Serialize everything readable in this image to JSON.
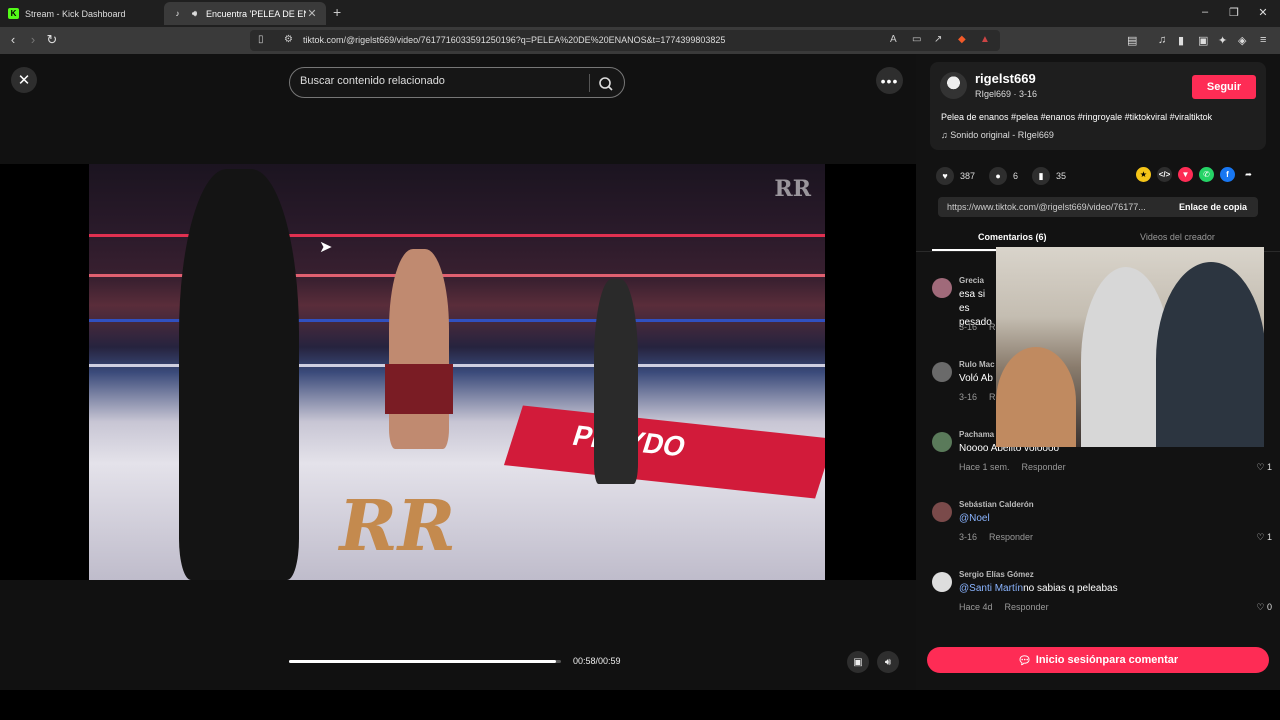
{
  "browser": {
    "tabs": [
      {
        "title": "Stream - Kick Dashboard",
        "favicon": "kick-icon",
        "active": false
      },
      {
        "title": "Encuentra 'PELEA DE ENANOS",
        "favicon": "tiktok-icon",
        "active": true
      }
    ],
    "new_tab_label": "+",
    "url": "tiktok.com/@rigelst669/video/7617716033591250196?q=PELEA%20DE%20ENANOS&t=1774399803825"
  },
  "player": {
    "search_placeholder": "Buscar contenido relacionado",
    "progress": 0.98,
    "time": "00:58/00:59"
  },
  "author": {
    "username": "rigelst669",
    "sub": "RIgel669 · 3-16",
    "follow_label": "Seguir",
    "description": "Pelea de enanos #pelea #enanos #ringroyale #tiktokviral #viraltiktok",
    "sound": "Sonido original - RIgel669"
  },
  "stats": {
    "likes": "387",
    "comments": "6",
    "saves": "35"
  },
  "share": {
    "link": "https://www.tiktok.com/@rigelst669/video/76177...",
    "copy_label": "Enlace de copia"
  },
  "tabs": {
    "comments": "Comentarios (6)",
    "creator_videos": "Videos del creador"
  },
  "comments": [
    {
      "name": "Grecia",
      "text": "esa si es pesado",
      "date": "3-16",
      "reply": "Re",
      "likes": ""
    },
    {
      "name": "Rulo Mac",
      "text": "Voló Ab",
      "date": "3-16",
      "reply": "Re",
      "likes": ""
    },
    {
      "name": "Pachama",
      "text": "Noooo Abelito voloooo",
      "date": "Hace 1 sem.",
      "reply": "Responder",
      "likes": "1"
    },
    {
      "name": "Sebástian Calderón",
      "mention": "@Noel",
      "text": "",
      "date": "3-16",
      "reply": "Responder",
      "likes": "1"
    },
    {
      "name": "Sergio Elías Gómez",
      "mention": "@Santi Martín",
      "text": "no sabias q peleabas",
      "date": "Hace 4d",
      "reply": "Responder",
      "likes": "0"
    }
  ],
  "login_label": "Inicio sesiónpara comentar",
  "colors": {
    "accent": "#fe2c55",
    "panel_bg": "#121212",
    "mention": "#8ab4ff"
  }
}
